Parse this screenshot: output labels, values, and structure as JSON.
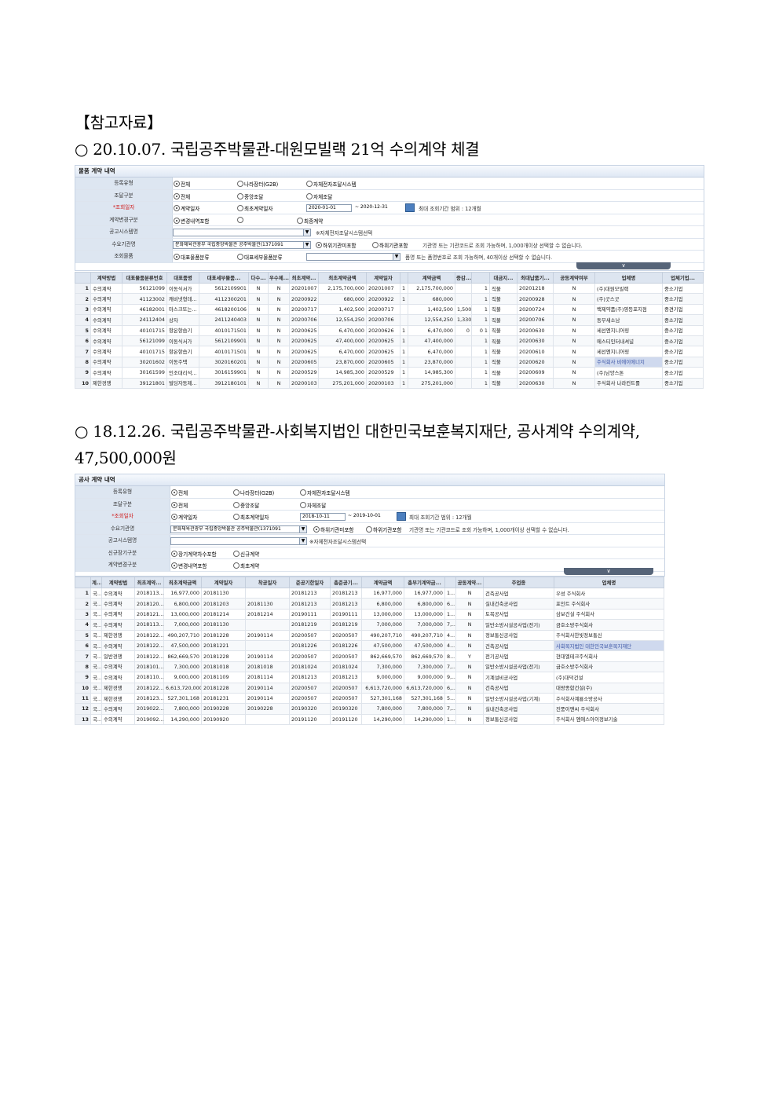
{
  "reference_title": "【참고자료】",
  "section1": {
    "heading": "○ 20.10.07. 국립공주박물관-대원모빌랙 21억 수의계약 체결",
    "panel_title": "물품 계약 내역",
    "labels": {
      "reg_type": "등록유형",
      "proc_type": "조달구분",
      "date": "*조회일자",
      "change_type": "계약변경구분",
      "notice_sys": "공고시스템명",
      "demand_org": "수요기관명",
      "goods": "조회물품"
    },
    "opts": {
      "all": "전체",
      "g2b": "나라장터(G2B)",
      "self_sys": "자체전자조달시스템",
      "all2": "전체",
      "central": "중앙조달",
      "self": "자체조달",
      "contract_date": "계약일자",
      "first_contract_date": "최초계약일자",
      "incl_change": "변경내역포함",
      "final_contract": "최종계약",
      "rep_class": "대표물품분류",
      "sub_class": "대표세부물품분류",
      "incl_sub_org": "하위기관미포함",
      "sub_org": "하위기관포함"
    },
    "date_from": "2020-01-01",
    "date_to": "~ 2020-12-31",
    "date_note": "최대 조회기간 범위 : 12개월",
    "notice_note": "※자체전자조달시스템선택",
    "org_value": "문화체육관광부 국립중앙박물관 공주박물관(1371091",
    "org_note": "기관명 또는 기관코드로 조회 가능하며, 1,000개이상 선택할 수 없습니다.",
    "goods_note": "품명 또는 품명번호로 조회 가능하며, 40개이상 선택할 수 없습니다.",
    "collapse": "∨",
    "columns": [
      "",
      "계약방법",
      "대표물품분류번호",
      "대표품명",
      "대표세부물품...",
      "다수...",
      "우수제...",
      "최초계약...",
      "최초계약금액",
      "계약일자",
      "",
      "계약금액",
      "증감...",
      "",
      "대금지...",
      "최대납품기...",
      "공동계약여부",
      "업체명",
      "업체기업..."
    ],
    "rows": [
      [
        "1",
        "수의계약",
        "56121099",
        "이동식서가",
        "5612109901",
        "N",
        "N",
        "20201007",
        "2,175,700,000",
        "20201007",
        "1",
        "2,175,700,000",
        "",
        "1",
        "직불",
        "20201218",
        "N",
        "(주)대원모빌랙",
        "중소기업"
      ],
      [
        "2",
        "수의계약",
        "41123002",
        "캐비넷형데...",
        "4112300201",
        "N",
        "N",
        "20200922",
        "680,000",
        "20200922",
        "1",
        "680,000",
        "",
        "1",
        "직불",
        "20200928",
        "N",
        "(주)굿스굿",
        "중소기업"
      ],
      [
        "3",
        "수의계약",
        "46182001",
        "마스크또는...",
        "4618200106",
        "N",
        "N",
        "20200717",
        "1,402,500",
        "20200717",
        "",
        "1,402,500",
        "1,500",
        "1",
        "직불",
        "20200724",
        "N",
        "백제약품(주)영등포지점",
        "중견기업"
      ],
      [
        "4",
        "수의계약",
        "24112404",
        "상자",
        "2411240403",
        "N",
        "N",
        "20200706",
        "12,554,250",
        "20200706",
        "",
        "12,554,250",
        "1,330",
        "1",
        "직불",
        "20200706",
        "N",
        "동부새소남",
        "중소기업"
      ],
      [
        "5",
        "수의계약",
        "40101715",
        "항온항습기",
        "4010171501",
        "N",
        "N",
        "20200625",
        "6,470,000",
        "20200626",
        "1",
        "6,470,000",
        "0",
        "0 1",
        "직불",
        "20200630",
        "N",
        "세선엔지니어링",
        "중소기업"
      ],
      [
        "6",
        "수의계약",
        "56121099",
        "이동식서가",
        "5612109901",
        "N",
        "N",
        "20200625",
        "47,400,000",
        "20200625",
        "1",
        "47,400,000",
        "",
        "1",
        "직불",
        "20200630",
        "N",
        "에스티인터내셔널",
        "중소기업"
      ],
      [
        "7",
        "수의계약",
        "40101715",
        "항온항습기",
        "4010171501",
        "N",
        "N",
        "20200625",
        "6,470,000",
        "20200625",
        "1",
        "6,470,000",
        "",
        "1",
        "직불",
        "20200610",
        "N",
        "세선엔지니어링",
        "중소기업"
      ],
      [
        "8",
        "수의계약",
        "30201602",
        "이동주택",
        "3020160201",
        "N",
        "N",
        "20200605",
        "23,870,000",
        "20200605",
        "1",
        "23,870,000",
        "",
        "1",
        "직불",
        "20200620",
        "N",
        "주식회사 비에이에너지",
        "중소기업"
      ],
      [
        "9",
        "수의계약",
        "30161599",
        "인조대리석...",
        "3016159901",
        "N",
        "N",
        "20200529",
        "14,985,300",
        "20200529",
        "1",
        "14,985,300",
        "",
        "1",
        "직불",
        "20200609",
        "N",
        "(주)남양스톤",
        "중소기업"
      ],
      [
        "10",
        "제한경쟁",
        "39121801",
        "벌딩자동제...",
        "3912180101",
        "N",
        "N",
        "20200103",
        "275,201,000",
        "20200103",
        "1",
        "275,201,000",
        "",
        "1",
        "직불",
        "20200630",
        "N",
        "주식회사 나라컨트롤",
        "중소기업"
      ]
    ]
  },
  "section2": {
    "heading": "○ 18.12.26. 국립공주박물관-사회복지법인 대한민국보훈복지재단, 공사계약 수의계약,",
    "heading_cont": "47,500,000원",
    "panel_title": "공사 계약 내역",
    "labels": {
      "reg_type": "등록유형",
      "proc_type": "조달구분",
      "date": "*조회일자",
      "demand_org": "수요기관명",
      "notice_sys": "공고시스템명",
      "cont_type": "신규장기구분",
      "change_type": "계약변경구분"
    },
    "opts": {
      "all": "전체",
      "g2b": "나라장터(G2B)",
      "self_sys": "자체전자조달시스템",
      "all2": "전체",
      "central": "중앙조달",
      "self": "자체조달",
      "contract_date": "계약일자",
      "first_contract_date": "최초계약일자",
      "incl_sub_org": "하위기관미포함",
      "sub_org": "하위기관포함",
      "long_term": "장기계약차수포함",
      "new_contract": "신규계약",
      "incl_change": "변경내역포함",
      "first_contract": "최초계약"
    },
    "date_from": "2018-10-11",
    "date_to": "~ 2019-10-01",
    "date_note": "최대 조회기간 범위 : 12개월",
    "org_value": "문화체육관광부 국립중앙박물관 공주박물관(1371091",
    "org_note": "기관명 또는 기관코드로 조회 가능하며, 1,000개이상 선택할 수 없습니다.",
    "notice_note": "※자체전자조달시스템선택",
    "collapse": "∨",
    "columns": [
      "",
      "계...",
      "계약방법",
      "최초계약...",
      "최초계약금액",
      "계약일자",
      "착공일자",
      "준공기한일자",
      "총준공기...",
      "계약금액",
      "총부기계약금...",
      "",
      "공동계약...",
      "주업종",
      "업체명"
    ],
    "rows": [
      [
        "1",
        "국...",
        "수의계약",
        "2018113...",
        "16,977,000",
        "20181130",
        "",
        "20181213",
        "20181213",
        "16,977,000",
        "16,977,000",
        "1...",
        "N",
        "건축공사업",
        "우성 주식회사"
      ],
      [
        "2",
        "국...",
        "수의계약",
        "2018120...",
        "6,800,000",
        "20181203",
        "20181130",
        "20181213",
        "20181213",
        "6,800,000",
        "6,800,000",
        "6...",
        "N",
        "실내건축공사업",
        "포인트 주식회사"
      ],
      [
        "3",
        "국...",
        "수의계약",
        "2018121...",
        "13,000,000",
        "20181214",
        "20181214",
        "20190111",
        "20190111",
        "13,000,000",
        "13,000,000",
        "1...",
        "N",
        "토목공사업",
        "삼보건설 주식회사"
      ],
      [
        "4",
        "국...",
        "수의계약",
        "2018113...",
        "7,000,000",
        "20181130",
        "",
        "20181219",
        "20181219",
        "7,000,000",
        "7,000,000",
        "7,...",
        "N",
        "일반소방시설공사업(전기)",
        "금호소방주식회사"
      ],
      [
        "5",
        "국...",
        "제한경쟁",
        "2018122...",
        "490,207,710",
        "20181228",
        "20190114",
        "20200507",
        "20200507",
        "490,207,710",
        "490,207,710",
        "4...",
        "N",
        "정보통신공사업",
        "주식회사한빛정보통신"
      ],
      [
        "6",
        "국...",
        "수의계약",
        "2018122...",
        "47,500,000",
        "20181221",
        "",
        "20181226",
        "20181226",
        "47,500,000",
        "47,500,000",
        "4...",
        "N",
        "건축공사업",
        "사회복지법인 대한민국보훈복지재단"
      ],
      [
        "7",
        "국...",
        "일반경쟁",
        "2018122...",
        "862,669,570",
        "20181228",
        "20190114",
        "20200507",
        "20200507",
        "862,669,570",
        "862,669,570",
        "8...",
        "Y",
        "전기공사업",
        "현대엘테크주식회사"
      ],
      [
        "8",
        "국...",
        "수의계약",
        "2018101...",
        "7,300,000",
        "20181018",
        "20181018",
        "20181024",
        "20181024",
        "7,300,000",
        "7,300,000",
        "7,...",
        "N",
        "일반소방시설공사업(전기)",
        "금호소방주식회사"
      ],
      [
        "9",
        "국...",
        "수의계약",
        "2018110...",
        "9,000,000",
        "20181109",
        "20181114",
        "20181213",
        "20181213",
        "9,000,000",
        "9,000,000",
        "9,...",
        "N",
        "기계설비공사업",
        "(주)대덕건설"
      ],
      [
        "10",
        "국...",
        "제한경쟁",
        "2018122...",
        "6,613,720,000",
        "20181228",
        "20190114",
        "20200507",
        "20200507",
        "6,613,720,000",
        "6,613,720,000",
        "6,...",
        "N",
        "건축공사업",
        "대왕종합건설(주)"
      ],
      [
        "11",
        "국...",
        "제한경쟁",
        "2018123...",
        "527,301,168",
        "20181231",
        "20190114",
        "20200507",
        "20200507",
        "527,301,168",
        "527,301,168",
        "5...",
        "N",
        "일반소방시설공사업(기계)",
        "주식회사계룡소방공사"
      ],
      [
        "12",
        "국...",
        "수의계약",
        "2019022...",
        "7,800,000",
        "20190228",
        "20190228",
        "20190320",
        "20190320",
        "7,800,000",
        "7,800,000",
        "7,...",
        "N",
        "실내건축공사업",
        "진풍이앤씨 주식회사"
      ],
      [
        "13",
        "국...",
        "수의계약",
        "2019092...",
        "14,290,000",
        "20190920",
        "",
        "20191120",
        "20191120",
        "14,290,000",
        "14,290,000",
        "1...",
        "N",
        "정보통신공사업",
        "주식회사 엠에스아이정보기술"
      ]
    ]
  }
}
